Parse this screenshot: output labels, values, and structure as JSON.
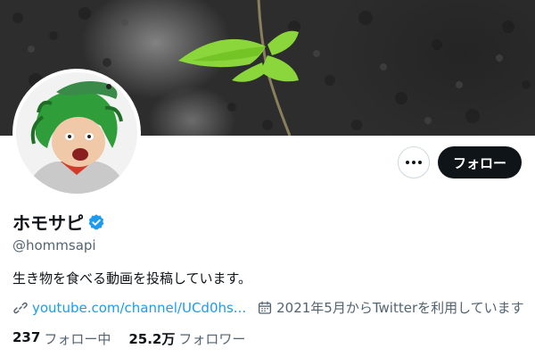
{
  "profile": {
    "display_name": "ホモサピ",
    "handle": "@hommsapi",
    "bio": "生き物を食べる動画を投稿しています。",
    "website": "youtube.com/channel/UCd0hs...",
    "joined": "2021年5月からTwitterを利用しています"
  },
  "actions": {
    "follow_label": "フォロー"
  },
  "stats": {
    "following_count": "237",
    "following_label": "フォロー中",
    "followers_count": "25.2万",
    "followers_label": "フォロワー"
  },
  "icons": {
    "more": "more-horizontal-icon",
    "verified": "verified-badge-icon",
    "link": "link-icon",
    "calendar": "calendar-icon"
  },
  "colors": {
    "accent": "#1d9bf0",
    "follow_button": "#0f1419",
    "secondary_text": "#536471"
  }
}
